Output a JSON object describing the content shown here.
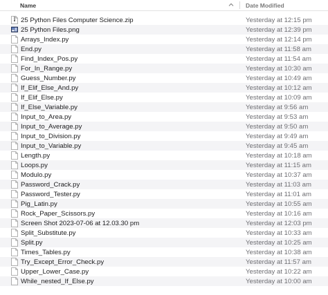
{
  "header": {
    "name_label": "Name",
    "date_label": "Date Modified"
  },
  "files": [
    {
      "name": "25 Python Files Computer Science.zip",
      "date": "Yesterday at 12:15 pm",
      "icon": "zip-icon"
    },
    {
      "name": "25 Python Files.png",
      "date": "Yesterday at 12:39 pm",
      "icon": "image-icon"
    },
    {
      "name": "Arrays_Index.py",
      "date": "Yesterday at 12:14 pm",
      "icon": "document-icon"
    },
    {
      "name": "End.py",
      "date": "Yesterday at 11:58 am",
      "icon": "document-icon"
    },
    {
      "name": "Find_Index_Pos.py",
      "date": "Yesterday at 11:54 am",
      "icon": "document-icon"
    },
    {
      "name": "For_In_Range.py",
      "date": "Yesterday at 10:30 am",
      "icon": "document-icon"
    },
    {
      "name": "Guess_Number.py",
      "date": "Yesterday at 10:49 am",
      "icon": "document-icon"
    },
    {
      "name": "If_Elif_Else_And.py",
      "date": "Yesterday at 10:12 am",
      "icon": "document-icon"
    },
    {
      "name": "If_Elif_Else.py",
      "date": "Yesterday at 10:09 am",
      "icon": "document-icon"
    },
    {
      "name": "If_Else_Variable.py",
      "date": "Yesterday at 9:56 am",
      "icon": "document-icon"
    },
    {
      "name": "Input_to_Area.py",
      "date": "Yesterday at 9:53 am",
      "icon": "document-icon"
    },
    {
      "name": "Input_to_Average.py",
      "date": "Yesterday at 9:50 am",
      "icon": "document-icon"
    },
    {
      "name": "Input_to_Division.py",
      "date": "Yesterday at 9:49 am",
      "icon": "document-icon"
    },
    {
      "name": "Input_to_Variable.py",
      "date": "Yesterday at 9:45 am",
      "icon": "document-icon"
    },
    {
      "name": "Length.py",
      "date": "Yesterday at 10:18 am",
      "icon": "document-icon"
    },
    {
      "name": "Loops.py",
      "date": "Yesterday at 11:15 am",
      "icon": "document-icon"
    },
    {
      "name": "Modulo.py",
      "date": "Yesterday at 10:37 am",
      "icon": "document-icon"
    },
    {
      "name": "Password_Crack.py",
      "date": "Yesterday at 11:03 am",
      "icon": "document-icon"
    },
    {
      "name": "Password_Tester.py",
      "date": "Yesterday at 11:01 am",
      "icon": "document-icon"
    },
    {
      "name": "Pig_Latin.py",
      "date": "Yesterday at 10:55 am",
      "icon": "document-icon"
    },
    {
      "name": "Rock_Paper_Scissors.py",
      "date": "Yesterday at 10:16 am",
      "icon": "document-icon"
    },
    {
      "name": "Screen Shot 2023-07-06 at 12.03.30 pm",
      "date": "Yesterday at 12:03 pm",
      "icon": "document-icon"
    },
    {
      "name": "Split_Substitute.py",
      "date": "Yesterday at 10:33 am",
      "icon": "document-icon"
    },
    {
      "name": "Split.py",
      "date": "Yesterday at 10:25 am",
      "icon": "document-icon"
    },
    {
      "name": "Times_Tables.py",
      "date": "Yesterday at 10:38 am",
      "icon": "document-icon"
    },
    {
      "name": "Try_Except_Error_Check.py",
      "date": "Yesterday at 11:57 am",
      "icon": "document-icon"
    },
    {
      "name": "Upper_Lower_Case.py",
      "date": "Yesterday at 10:22 am",
      "icon": "document-icon"
    },
    {
      "name": "While_nested_If_Else.py",
      "date": "Yesterday at 10:00 am",
      "icon": "document-icon"
    }
  ]
}
